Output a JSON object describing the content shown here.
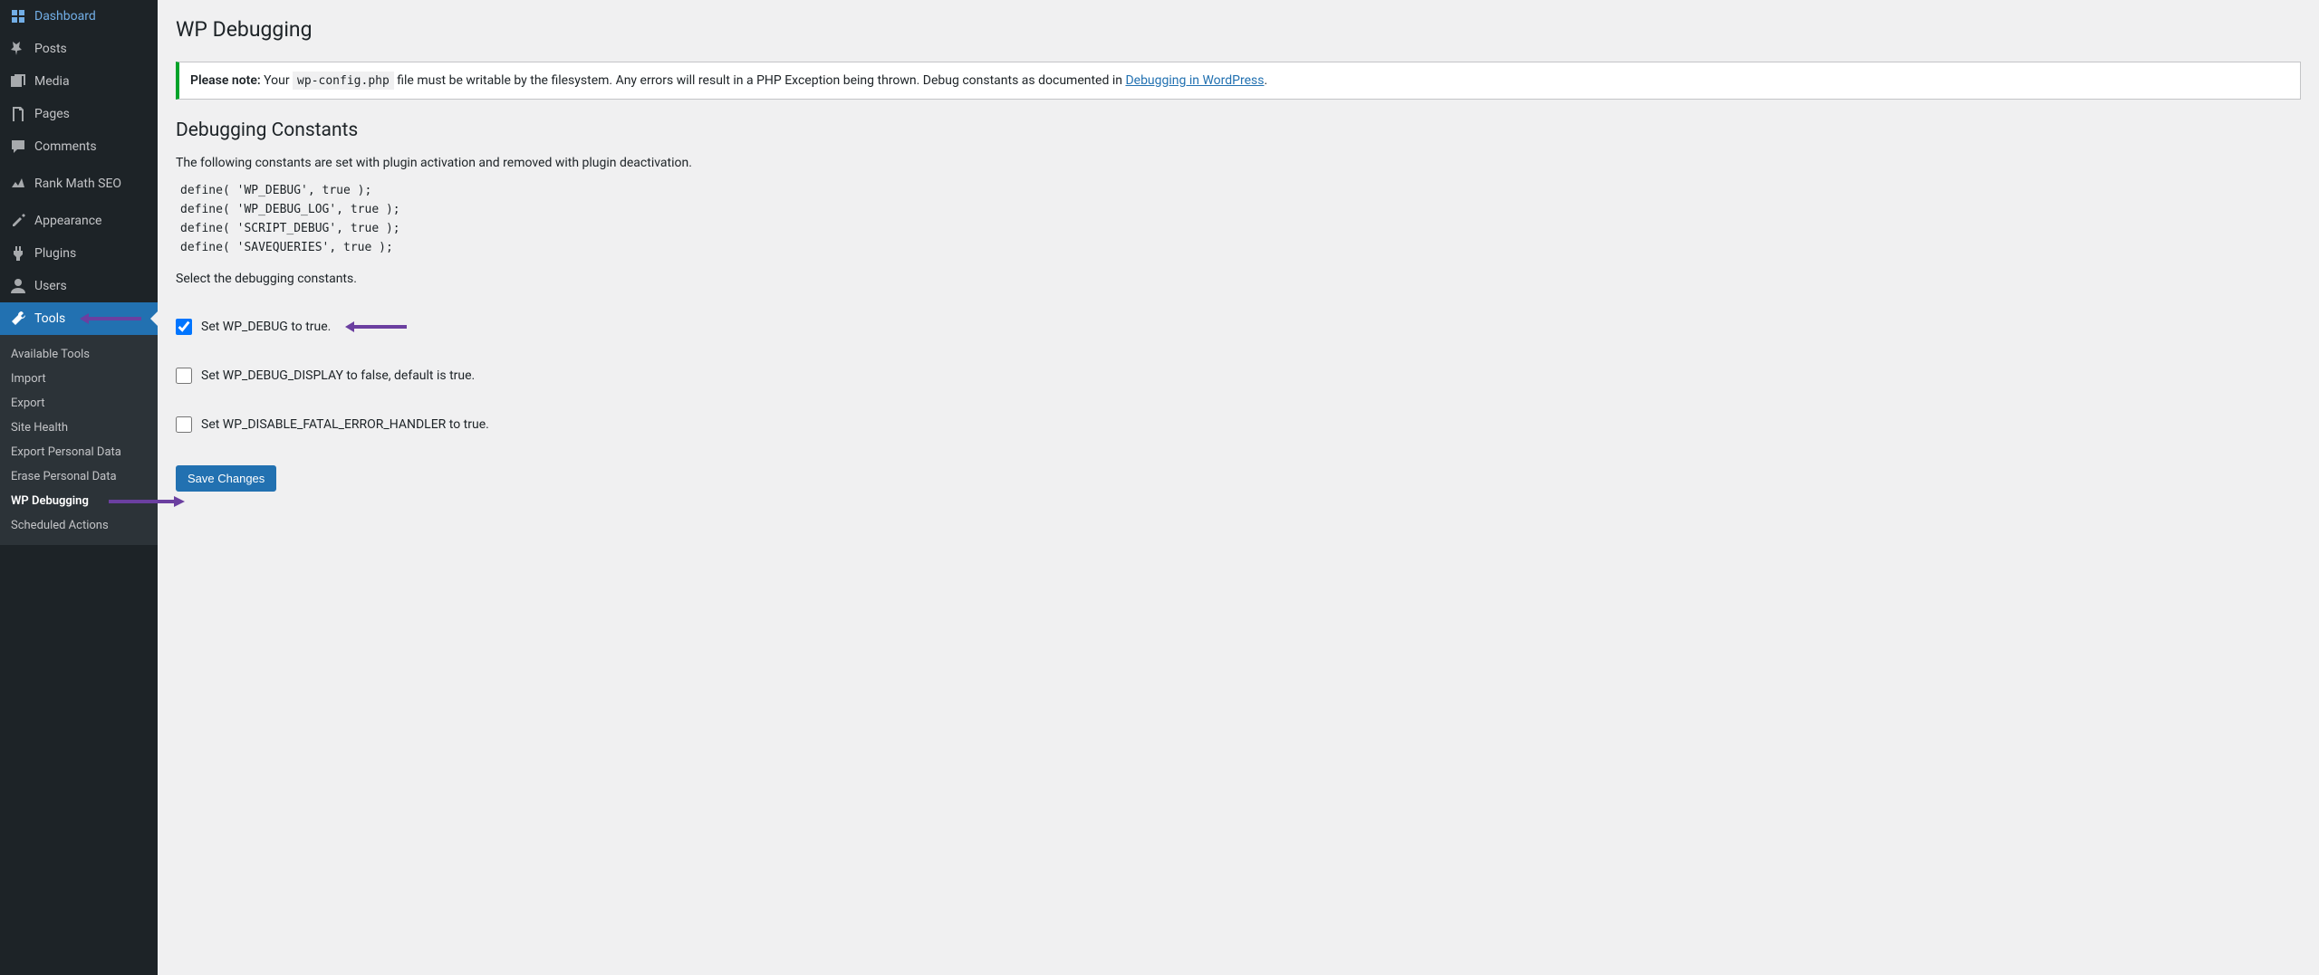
{
  "sidebar": {
    "items": [
      {
        "icon": "dashboard",
        "label": "Dashboard"
      },
      {
        "icon": "pin",
        "label": "Posts"
      },
      {
        "icon": "media",
        "label": "Media"
      },
      {
        "icon": "pages",
        "label": "Pages"
      },
      {
        "icon": "comments",
        "label": "Comments"
      },
      {
        "icon": "rankmath",
        "label": "Rank Math SEO"
      },
      {
        "icon": "appearance",
        "label": "Appearance"
      },
      {
        "icon": "plugins",
        "label": "Plugins"
      },
      {
        "icon": "users",
        "label": "Users"
      },
      {
        "icon": "tools",
        "label": "Tools",
        "active": true
      }
    ],
    "submenu": [
      {
        "label": "Available Tools"
      },
      {
        "label": "Import"
      },
      {
        "label": "Export"
      },
      {
        "label": "Site Health"
      },
      {
        "label": "Export Personal Data"
      },
      {
        "label": "Erase Personal Data"
      },
      {
        "label": "WP Debugging",
        "current": true
      },
      {
        "label": "Scheduled Actions"
      }
    ]
  },
  "page": {
    "title": "WP Debugging",
    "notice": {
      "strong": "Please note:",
      "before_code": " Your ",
      "code": "wp-config.php",
      "after_code": " file must be writable by the filesystem. Any errors will result in a PHP Exception being thrown. Debug constants as documented in ",
      "link": "Debugging in WordPress",
      "after_link": "."
    },
    "section_heading": "Debugging Constants",
    "constants_desc": "The following constants are set with plugin activation and removed with plugin deactivation.",
    "defines": [
      "define( 'WP_DEBUG', true );",
      "define( 'WP_DEBUG_LOG', true );",
      "define( 'SCRIPT_DEBUG', true );",
      "define( 'SAVEQUERIES', true );"
    ],
    "select_desc": "Select the debugging constants.",
    "options": [
      {
        "label": "Set WP_DEBUG to true.",
        "checked": true,
        "arrow": true
      },
      {
        "label": "Set WP_DEBUG_DISPLAY to false, default is true.",
        "checked": false
      },
      {
        "label": "Set WP_DISABLE_FATAL_ERROR_HANDLER to true.",
        "checked": false
      }
    ],
    "save_label": "Save Changes"
  },
  "colors": {
    "arrow": "#6b3fa0",
    "primary": "#2271b1"
  }
}
